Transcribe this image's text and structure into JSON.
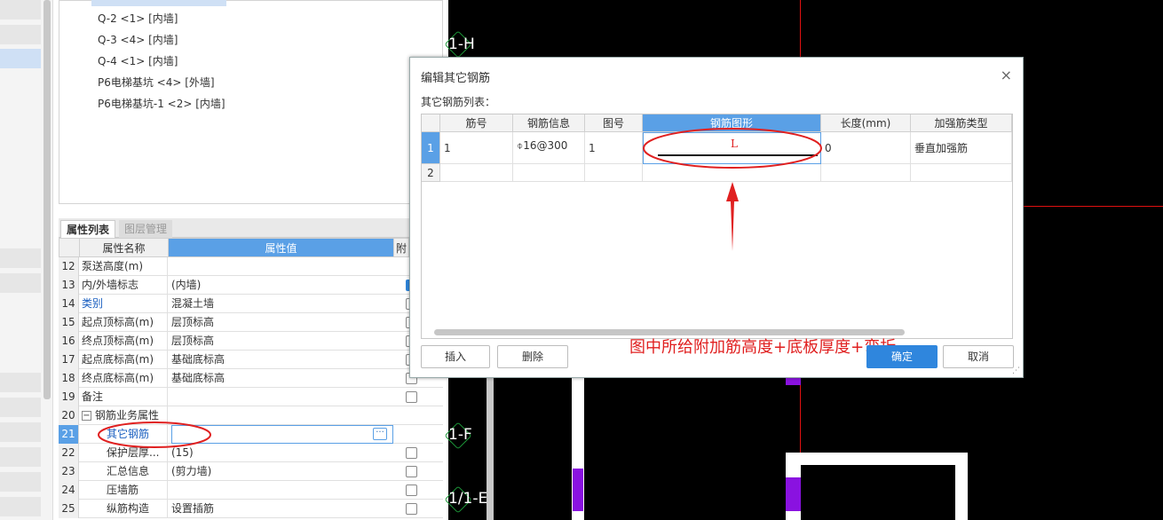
{
  "tree": {
    "items": [
      "Q-2 <1> [内墙]",
      "Q-3 <4> [内墙]",
      "Q-4 <1> [内墙]",
      "P6电梯基坑 <4> [外墙]",
      "P6电梯基坑-1 <2> [内墙]"
    ]
  },
  "tabs": {
    "properties": "属性列表",
    "layers": "图层管理"
  },
  "grid": {
    "col_name": "属性名称",
    "col_value": "属性值",
    "col_extra": "附",
    "rows": [
      {
        "num": "12",
        "name": "泵送高度(m)",
        "value": "",
        "checkbox": false
      },
      {
        "num": "13",
        "name": "内/外墙标志",
        "value": "(内墙)",
        "checkbox": true
      },
      {
        "num": "14",
        "name": "类别",
        "value": "混凝土墙",
        "checkbox": true
      },
      {
        "num": "15",
        "name": "起点顶标高(m)",
        "value": "层顶标高",
        "checkbox": true
      },
      {
        "num": "16",
        "name": "终点顶标高(m)",
        "value": "层顶标高",
        "checkbox": true
      },
      {
        "num": "17",
        "name": "起点底标高(m)",
        "value": "基础底标高",
        "checkbox": true
      },
      {
        "num": "18",
        "name": "终点底标高(m)",
        "value": "基础底标高",
        "checkbox": true
      },
      {
        "num": "19",
        "name": "备注",
        "value": "",
        "checkbox": true
      },
      {
        "num": "20",
        "name": "钢筋业务属性",
        "value": "",
        "checkbox": false
      },
      {
        "num": "21",
        "name": "其它钢筋",
        "value": "",
        "checkbox": false
      },
      {
        "num": "22",
        "name": "保护层厚...",
        "value": "(15)",
        "checkbox": true
      },
      {
        "num": "23",
        "name": "汇总信息",
        "value": "(剪力墙)",
        "checkbox": true
      },
      {
        "num": "24",
        "name": "压墙筋",
        "value": "",
        "checkbox": true
      },
      {
        "num": "25",
        "name": "纵筋构造",
        "value": "设置插筋",
        "checkbox": true
      }
    ],
    "collapse_symbol": "−",
    "ellipsis": "···"
  },
  "canvas": {
    "axis_labels": [
      "1-H",
      "1-F",
      "1/1-E"
    ]
  },
  "dialog": {
    "title": "编辑其它钢筋",
    "close": "×",
    "subtitle": "其它钢筋列表：",
    "columns": [
      "筋号",
      "钢筋信息",
      "图号",
      "钢筋图形",
      "长度(mm)",
      "加强筋类型"
    ],
    "rows": [
      {
        "num": "1",
        "bar_no": "1",
        "bar_info": "⌽16@300",
        "figure_no": "1",
        "shape_label": "L",
        "length": "0",
        "type": "垂直加强筋"
      },
      {
        "num": "2",
        "bar_no": "",
        "bar_info": "",
        "figure_no": "",
        "shape_label": "",
        "length": "",
        "type": ""
      }
    ],
    "annotation": "图中所给附加筋高度+底板厚度+弯折",
    "buttons": {
      "insert": "插入",
      "delete": "删除",
      "ok": "确定",
      "cancel": "取消"
    }
  },
  "colors": {
    "accent": "#2f86dd",
    "annotation": "#e02020",
    "selection": "#cfe0f5"
  }
}
